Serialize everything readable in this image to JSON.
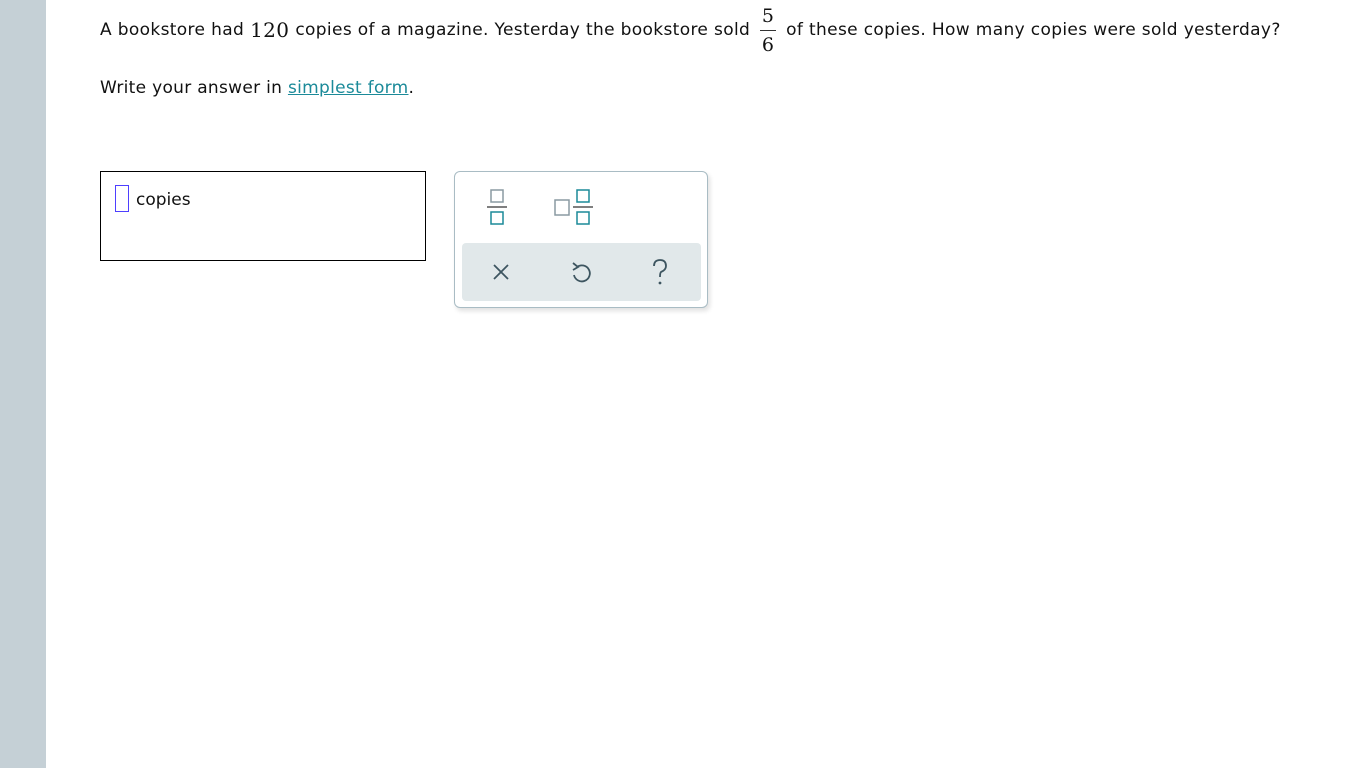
{
  "question": {
    "part1": "A bookstore had",
    "quantity": "120",
    "part2": "copies of a magazine. Yesterday the bookstore sold",
    "fraction": {
      "numerator": "5",
      "denominator": "6"
    },
    "part3": "of these copies. How many copies were sold yesterday?"
  },
  "instruction": {
    "prefix": "Write your answer in",
    "link_text": "simplest form",
    "suffix": "."
  },
  "answer": {
    "value": "",
    "unit": "copies"
  },
  "palette": {
    "tools": [
      "fraction-template-icon",
      "mixed-number-template-icon"
    ],
    "actions": [
      "clear-icon",
      "undo-icon",
      "help-icon"
    ]
  },
  "colors": {
    "accent": "#1b8a99",
    "cursor": "#4e3fff",
    "rail": "#c5d0d6",
    "action_bar": "#e1e8ea"
  }
}
